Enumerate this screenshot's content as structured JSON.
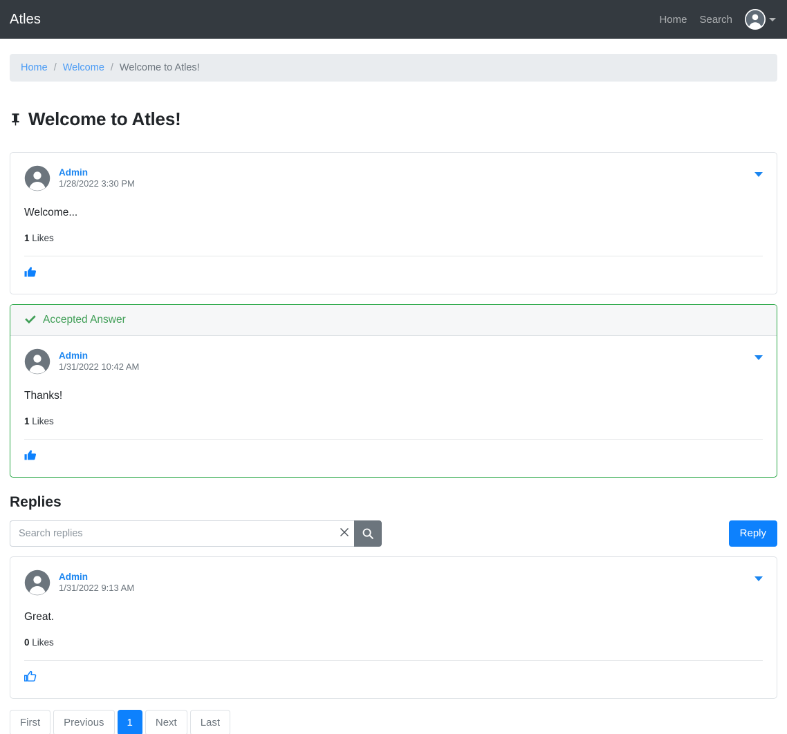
{
  "navbar": {
    "brand": "Atles",
    "links": [
      {
        "label": "Home",
        "icon": ""
      },
      {
        "label": "Search",
        "icon": ""
      }
    ],
    "user_icon": "user-avatar-icon",
    "caret_icon": "chevron-down-icon"
  },
  "breadcrumb": {
    "items": [
      {
        "label": "Home",
        "link": true
      },
      {
        "label": "Welcome",
        "link": true
      },
      {
        "label": "Welcome to Atles!",
        "link": false
      }
    ],
    "separator": "/"
  },
  "page": {
    "pin_icon": "pin-icon",
    "title": "Welcome to Atles!"
  },
  "topic": {
    "author": "Admin",
    "date": "1/28/2022 3:30 PM",
    "content": "Welcome...",
    "likes_count": "1",
    "likes_label": "Likes",
    "menu_icon": "chevron-down-icon",
    "like_icon": "thumbs-up-filled-icon",
    "avatar_icon": "user-avatar-icon"
  },
  "accepted_answer": {
    "header_label": "Accepted Answer",
    "check_icon": "check-icon",
    "author": "Admin",
    "date": "1/31/2022 10:42 AM",
    "content": "Thanks!",
    "likes_count": "1",
    "likes_label": "Likes",
    "menu_icon": "chevron-down-icon",
    "like_icon": "thumbs-up-filled-icon",
    "avatar_icon": "user-avatar-icon"
  },
  "replies": {
    "title": "Replies",
    "search_placeholder": "Search replies",
    "search_value": "",
    "clear_icon": "close-icon",
    "search_icon": "search-icon",
    "reply_button": "Reply",
    "items": [
      {
        "author": "Admin",
        "date": "1/31/2022 9:13 AM",
        "content": "Great.",
        "likes_count": "0",
        "likes_label": "Likes",
        "menu_icon": "chevron-down-icon",
        "like_icon": "thumbs-up-outline-icon",
        "avatar_icon": "user-avatar-icon"
      }
    ]
  },
  "pagination": {
    "first": "First",
    "previous": "Previous",
    "current": "1",
    "next": "Next",
    "last": "Last"
  },
  "colors": {
    "navbar_bg": "#343a40",
    "link_blue": "#1a85f0",
    "primary_blue": "#0d81fd",
    "accepted_green": "#28a745",
    "breadcrumb_bg": "#e9ecef",
    "muted_gray": "#6c757d",
    "border_gray": "#dee2e6"
  }
}
